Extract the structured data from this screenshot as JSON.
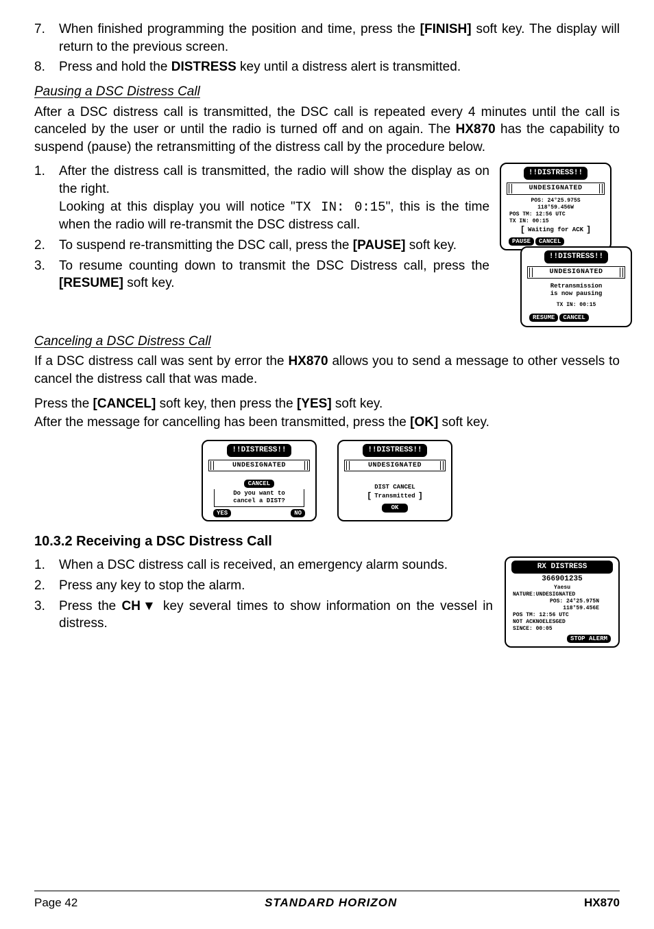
{
  "intro_list": [
    {
      "n": "7.",
      "text_before": "When finished programming the position and time, press the ",
      "bold1": "[FINISH]",
      "text_after": " soft key. The display will return to the previous screen."
    },
    {
      "n": "8.",
      "text_before": "Press and hold the ",
      "bold1": "DISTRESS",
      "text_after": " key until a distress alert is transmitted."
    }
  ],
  "pause_heading": "Pausing a DSC Distress Call",
  "pause_para_a": "After a DSC distress call is transmitted, the DSC call is repeated every 4 minutes until the call is canceled by the user or until the radio is turned off and on again. The ",
  "pause_para_bold": "HX870",
  "pause_para_b": " has the capability to suspend (pause) the retransmitting of the distress call by the procedure below.",
  "pause_list": {
    "i1a": "After the distress call is transmitted, the radio will show the display as on the right.",
    "i1b_pre": "Looking at this display you will notice \"",
    "i1b_mono": "TX IN: 0:15",
    "i1b_post": "\", this is the time when the radio will re-transmit the DSC distress call.",
    "i2_pre": "To suspend re-transmitting the DSC call, press the ",
    "i2_bold": "[PAUSE]",
    "i2_post": " soft key.",
    "i3_pre": "To resume counting down to transmit the DSC Distress call, press the ",
    "i3_bold": "[RESUME]",
    "i3_post": " soft key."
  },
  "cancel_heading": "Canceling a DSC Distress Call",
  "cancel_para_a": "If a DSC distress call was sent by error the ",
  "cancel_para_bold": "HX870",
  "cancel_para_b": " allows you to send a message to other vessels to cancel the distress call that was made.",
  "cancel_line2_a": "Press the ",
  "cancel_line2_b1": "[CANCEL]",
  "cancel_line2_mid": " soft key, then press the ",
  "cancel_line2_b2": "[YES]",
  "cancel_line2_end": " soft key.",
  "cancel_line3_a": "After the message for cancelling has been transmitted, press the ",
  "cancel_line3_b": "[OK]",
  "cancel_line3_end": " soft key.",
  "recv_heading": "10.3.2  Receiving a DSC Distress Call",
  "recv_list": {
    "i1": "When a DSC distress call is received, an emergency alarm sounds.",
    "i2": "Press any key to stop the alarm.",
    "i3_pre": "Press the ",
    "i3_bold": "CH▼",
    "i3_post": " key several times to show information on the vessel in distress."
  },
  "dev1": {
    "title": "!!DISTRESS!!",
    "sub": "UNDESIGNATED",
    "lines": [
      "POS: 24°25.975S",
      "118°59.456W",
      "POS TM: 12:56 UTC",
      "TX IN: 00:15",
      "Waiting for ACK"
    ],
    "softs": [
      "PAUSE",
      "CANCEL"
    ]
  },
  "dev2": {
    "title": "!!DISTRESS!!",
    "sub": "UNDESIGNATED",
    "lines": [
      "Retransmission",
      "is now pausing",
      "TX IN: 00:15"
    ],
    "softs": [
      "RESUME",
      "CANCEL"
    ]
  },
  "dev3": {
    "title": "!!DISTRESS!!",
    "sub": "UNDESIGNATED",
    "mid_title": "CANCEL",
    "q1": "Do you want to",
    "q2": "cancel a DIST?",
    "softs": [
      "YES",
      "NO"
    ]
  },
  "dev4": {
    "title": "!!DISTRESS!!",
    "sub": "UNDESIGNATED",
    "l1": "DIST CANCEL",
    "l2": "Transmitted",
    "softs": [
      "OK"
    ]
  },
  "dev5": {
    "title": "RX DISTRESS",
    "lines": [
      "366901235",
      "Yaesu",
      "NATURE:UNDESIGNATED",
      "POS: 24°25.975N",
      "118°59.456E",
      "POS TM: 12:56 UTC",
      "NOT ACKNOELESGED",
      "SINCE: 00:05"
    ],
    "soft": "STOP ALERM"
  },
  "footer": {
    "page": "Page 42",
    "brand": "STANDARD HORIZON",
    "model": "HX870"
  }
}
